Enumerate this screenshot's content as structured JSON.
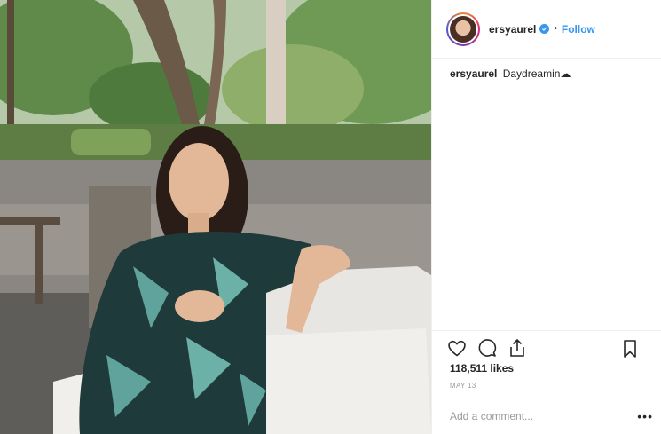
{
  "post": {
    "photo_alt": "photo",
    "colors": {
      "link": "#3897f0",
      "text": "#262626",
      "muted": "#999999",
      "border": "#efefef"
    }
  },
  "header": {
    "username": "ersyaurel",
    "separator": "•",
    "follow_label": "Follow"
  },
  "caption": {
    "username": "ersyaurel",
    "text": "Daydreamin☁"
  },
  "actions": {
    "icons": [
      "heart-icon",
      "comment-icon",
      "share-icon",
      "bookmark-icon"
    ]
  },
  "stats": {
    "likes": "118,511 likes",
    "date": "MAY 13"
  },
  "comment": {
    "placeholder": "Add a comment...",
    "more_label": "•••"
  }
}
